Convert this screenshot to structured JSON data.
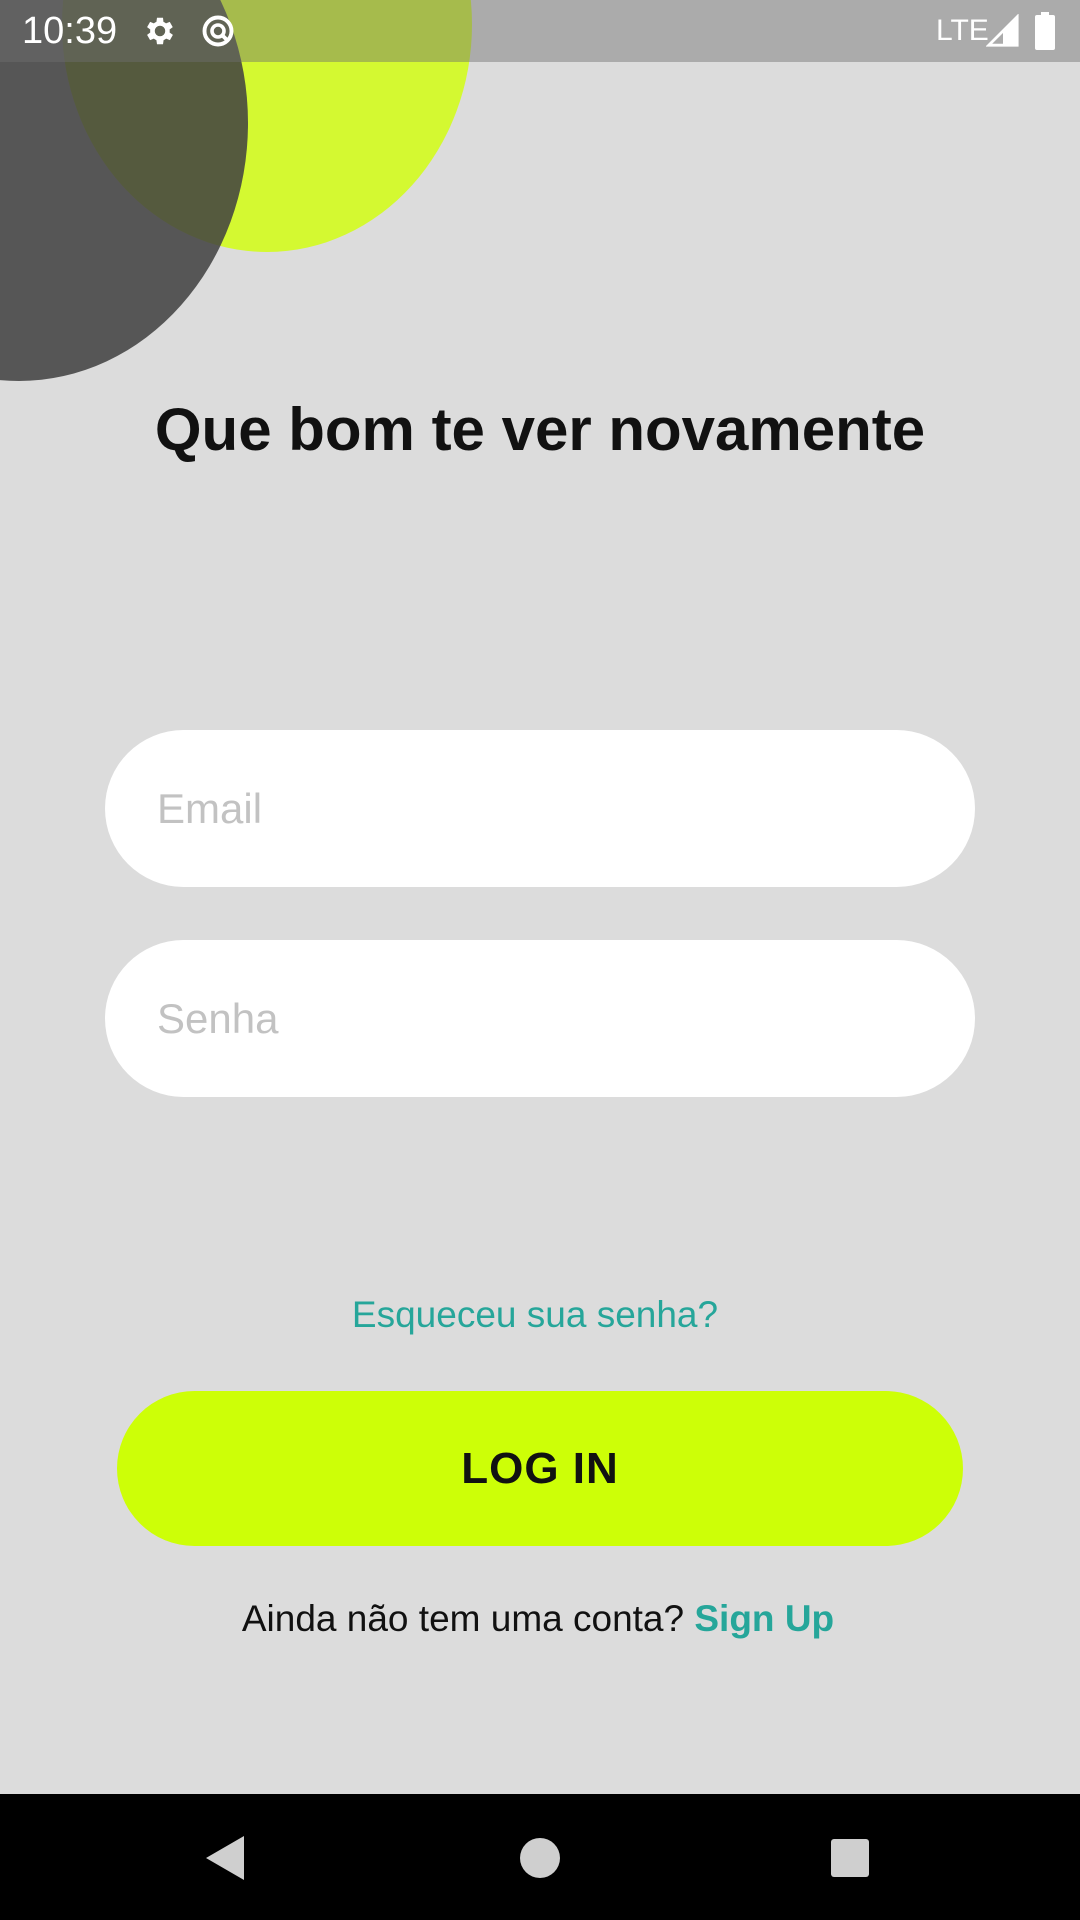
{
  "status_bar": {
    "time": "10:39",
    "network": "LTE",
    "icons": [
      "gear-icon",
      "sync-icon",
      "signal-icon",
      "battery-icon"
    ]
  },
  "login": {
    "title": "Que bom te ver novamente",
    "email_placeholder": "Email",
    "email_value": "",
    "password_placeholder": "Senha",
    "password_value": "",
    "forgot_password": "Esqueceu sua senha?",
    "login_button": "LOG IN",
    "no_account_text": "Ainda não tem uma conta?",
    "signup_link": "Sign Up"
  },
  "nav_bar": {
    "icons": [
      "back-icon",
      "home-icon",
      "recents-icon"
    ]
  },
  "colors": {
    "background": "#dcdcdc",
    "accent_lime": "#cdff07",
    "link_teal": "#26a69a",
    "dark_circle": "#404040",
    "text": "#111111"
  }
}
